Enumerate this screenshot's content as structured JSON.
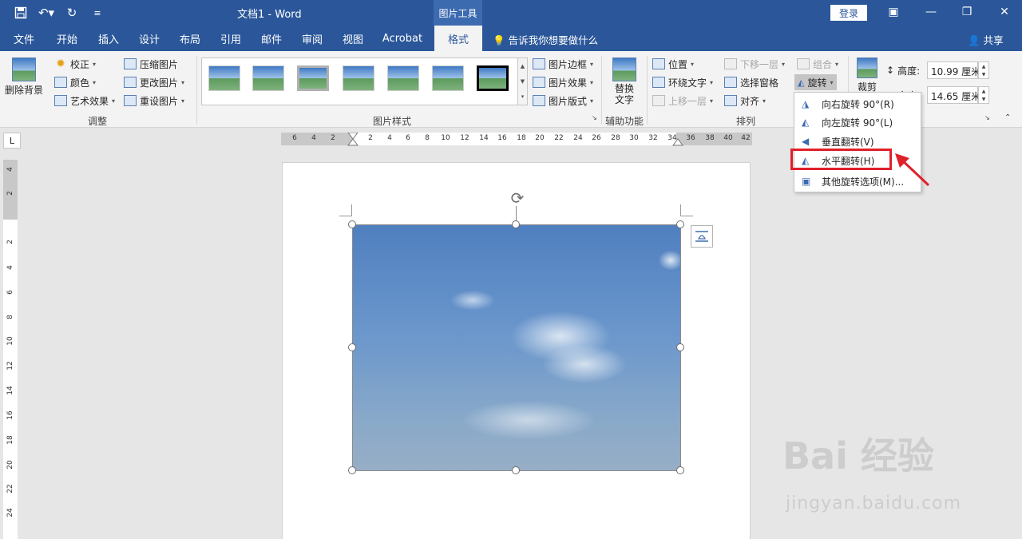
{
  "titlebar": {
    "title": "文档1  -  Word",
    "context_tab": "图片工具",
    "login": "登录"
  },
  "tabs": [
    "文件",
    "开始",
    "插入",
    "设计",
    "布局",
    "引用",
    "邮件",
    "审阅",
    "视图",
    "Acrobat",
    "格式"
  ],
  "active_tab": "格式",
  "tell_me": "告诉我你想要做什么",
  "share": "共享",
  "ribbon": {
    "remove_bg": "删除背景",
    "adjust": {
      "corrections": "校正",
      "color": "颜色",
      "artistic": "艺术效果",
      "compress": "压缩图片",
      "change": "更改图片",
      "reset": "重设图片",
      "label": "调整"
    },
    "styles": {
      "border": "图片边框",
      "effects": "图片效果",
      "layout": "图片版式",
      "label": "图片样式"
    },
    "accessibility": {
      "alt_text": "替换文字",
      "label": "辅助功能"
    },
    "arrange": {
      "position": "位置",
      "wrap": "环绕文字",
      "forward": "上移一层",
      "backward": "下移一层",
      "selection_pane": "选择窗格",
      "align": "对齐",
      "group": "组合",
      "rotate": "旋转",
      "label": "排列"
    },
    "size": {
      "crop": "裁剪",
      "height_label": "高度:",
      "height_value": "10.99 厘米",
      "width_label": "宽度:",
      "width_value": "14.65 厘米"
    }
  },
  "rotate_menu": {
    "items": [
      "向右旋转 90°(R)",
      "向左旋转 90°(L)",
      "垂直翻转(V)",
      "水平翻转(H)",
      "其他旋转选项(M)..."
    ],
    "highlighted": "水平翻转(H)"
  },
  "ruler": {
    "h_ticks": [
      "6",
      "4",
      "2",
      "2",
      "4",
      "6",
      "8",
      "10",
      "12",
      "14",
      "16",
      "18",
      "20",
      "22",
      "24",
      "26",
      "28",
      "30",
      "32",
      "34",
      "36",
      "38",
      "40",
      "42"
    ],
    "v_ticks": [
      "4",
      "2",
      "2",
      "4",
      "6",
      "8",
      "10",
      "12",
      "14",
      "16",
      "18",
      "20",
      "22",
      "24"
    ],
    "corner": "L"
  },
  "watermark": {
    "brand": "Bai  经验",
    "url": "jingyan.baidu.com"
  }
}
